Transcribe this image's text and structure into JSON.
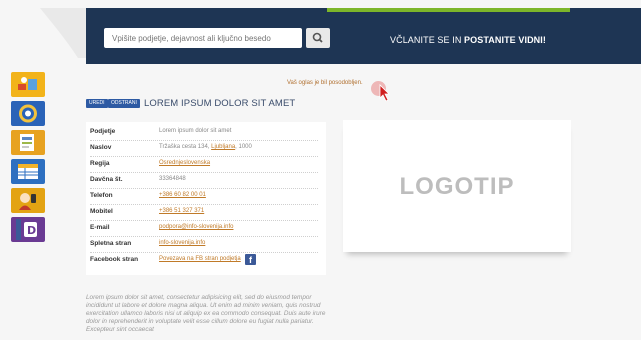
{
  "header": {
    "search_placeholder": "Vpišite podjetje, dejavnost ali ključno besedo",
    "member_prefix": "VČLANITE SE IN ",
    "member_bold": "POSTANITE VIDNI!"
  },
  "sidebar": {
    "icons": [
      {
        "name": "tools-tab-icon",
        "color": "#f2b31a"
      },
      {
        "name": "seal-tab-icon",
        "color": "#2a63b8"
      },
      {
        "name": "document-tab-icon",
        "color": "#e7a221"
      },
      {
        "name": "table-tab-icon",
        "color": "#2d6fc0"
      },
      {
        "name": "phone-tab-icon",
        "color": "#e3a313"
      },
      {
        "name": "facebook-tab-icon",
        "color": "#6a3a93",
        "label": "facebook"
      }
    ]
  },
  "notice": "Vaš oglas je bil posodobljen.",
  "badges": {
    "edit": "UREDI",
    "remove": "ODSTRANI"
  },
  "title": "LOREM IPSUM DOLOR SIT AMET",
  "details": [
    {
      "label": "Podjetje",
      "value": "Lorem ipsum dolor sit amet",
      "link": false
    },
    {
      "label": "Naslov",
      "value": "Tržaška cesta 134, ",
      "link_part": "Ljubljana",
      "suffix": ", 1000",
      "link": false
    },
    {
      "label": "Regija",
      "value": "Osrednjeslovenska",
      "link": true
    },
    {
      "label": "Davčna št.",
      "value": "33364848",
      "link": false
    },
    {
      "label": "Telefon",
      "value": "+386 60 82 00 01",
      "link": true
    },
    {
      "label": "Mobitel",
      "value": "+386 51 327 371",
      "link": true
    },
    {
      "label": "E-mail",
      "value": "podpora@info-slovenija.info",
      "link": true
    },
    {
      "label": "Spletna stran",
      "value": "info-slovenija.info",
      "link": true
    },
    {
      "label": "Facebook stran",
      "value": "Povezava na FB stran podjetja",
      "link": true
    }
  ],
  "logo_text": "LOGOTIP",
  "description": "Lorem ipsum dolor sit amet, consectetur adipisicing elit, sed do eiusmod tempor incididunt ut labore et dolore magna aliqua. Ut enim ad minim veniam, quis nostrud exercitation ullamco laboris nisi ut aliquip ex ea commodo consequat. Duis aute irure dolor in reprehenderit in voluptate velit esse cillum dolore eu fugiat nulla pariatur. Excepteur sint occaecat"
}
